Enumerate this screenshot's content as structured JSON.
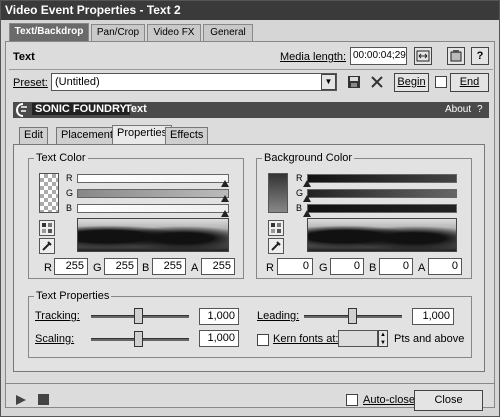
{
  "window": {
    "title": "Video Event Properties - Text 2"
  },
  "top_tabs": [
    "Text/Backdrop",
    "Pan/Crop",
    "Video FX",
    "General"
  ],
  "header": {
    "section_label": "Text",
    "media_length_label": "Media length:",
    "media_length_value": "00:00:04;29"
  },
  "preset": {
    "label": "Preset:",
    "value": "(Untitled)",
    "begin_label": "Begin",
    "end_label": "End"
  },
  "banner": {
    "brand": "SONIC FOUNDRY",
    "plugin_name": "Text",
    "about_label": "About",
    "help_label": "?"
  },
  "plugin_tabs": [
    "Edit",
    "Placement",
    "Properties",
    "Effects"
  ],
  "text_color": {
    "title": "Text Color",
    "channels": [
      "R",
      "G",
      "B"
    ],
    "values": {
      "R": "255",
      "G": "255",
      "B": "255",
      "A": "255"
    }
  },
  "background_color": {
    "title": "Background Color",
    "channels": [
      "R",
      "G",
      "B"
    ],
    "values": {
      "R": "0",
      "G": "0",
      "B": "0",
      "A": "0"
    }
  },
  "text_properties": {
    "title": "Text Properties",
    "tracking_label": "Tracking:",
    "tracking_value": "1,000",
    "scaling_label": "Scaling:",
    "scaling_value": "1,000",
    "leading_label": "Leading:",
    "leading_value": "1,000",
    "kern_label": "Kern fonts at:",
    "kern_value": "",
    "pts_label": "Pts and above"
  },
  "footer": {
    "auto_close_label": "Auto-close",
    "close_label": "Close"
  },
  "colors": {
    "titlebar": "#3a3a3a",
    "banner": "#4a4a4a",
    "panel": "#d6d6d6"
  }
}
